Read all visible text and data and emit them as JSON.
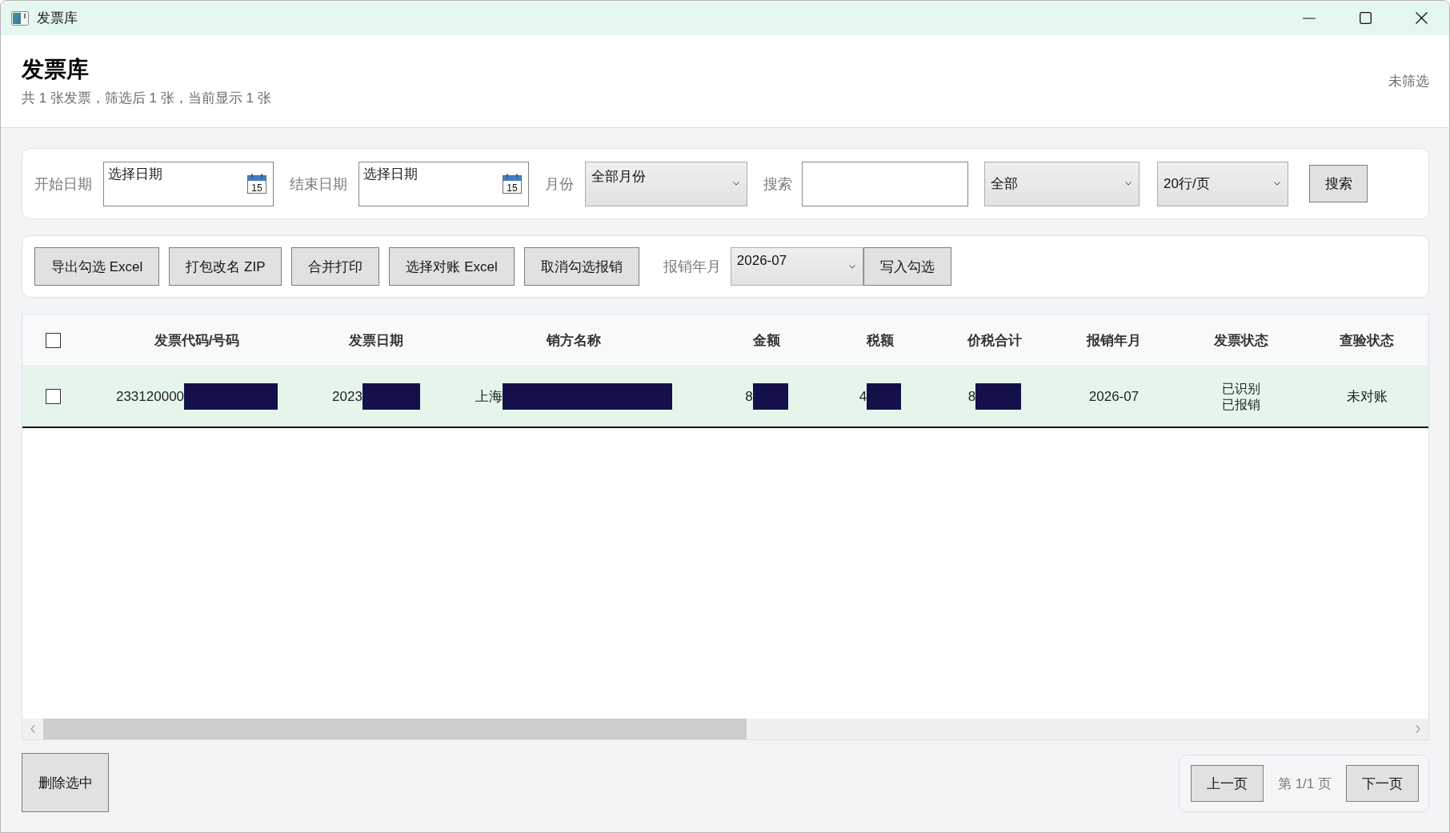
{
  "window": {
    "title": "发票库"
  },
  "header": {
    "title": "发票库",
    "subtitle": "共 1 张发票，筛选后 1 张，当前显示 1 张",
    "filter_status": "未筛选"
  },
  "filters": {
    "start_date": {
      "label": "开始日期",
      "placeholder": "选择日期",
      "calendar_day": "15"
    },
    "end_date": {
      "label": "结束日期",
      "placeholder": "选择日期",
      "calendar_day": "15"
    },
    "month": {
      "label": "月份",
      "value": "全部月份"
    },
    "search": {
      "label": "搜索"
    },
    "category": {
      "value": "全部"
    },
    "page_size": {
      "value": "20行/页"
    },
    "search_button": "搜索"
  },
  "actions": {
    "buttons": [
      "导出勾选 Excel",
      "打包改名 ZIP",
      "合并打印",
      "选择对账 Excel",
      "取消勾选报销"
    ],
    "reimburse_month": {
      "label": "报销年月",
      "value": "2026-07"
    },
    "apply_button": "写入勾选"
  },
  "table": {
    "select_all": {
      "checked": false
    },
    "columns": [
      "发票代码/号码",
      "发票日期",
      "销方名称",
      "金额",
      "税额",
      "价税合计",
      "报销年月",
      "发票状态",
      "查验状态"
    ],
    "rows": [
      {
        "selected": true,
        "checked": false,
        "cells": [
          {
            "kind": "redacted",
            "text": "233120000"
          },
          {
            "kind": "redacted",
            "text": "2023"
          },
          {
            "kind": "redacted",
            "text": "上海"
          },
          {
            "kind": "redacted",
            "text": "8"
          },
          {
            "kind": "redacted",
            "text": "4"
          },
          {
            "kind": "redacted",
            "text": "8"
          },
          {
            "kind": "text",
            "text": "2026-07"
          },
          {
            "kind": "lines",
            "lines": [
              "已识别",
              "已报销"
            ]
          },
          {
            "kind": "text",
            "text": "未对账"
          }
        ]
      }
    ]
  },
  "delete_button": "删除选中",
  "pagination": {
    "prev": "上一页",
    "info": "第 1/1 页",
    "next": "下一页"
  }
}
